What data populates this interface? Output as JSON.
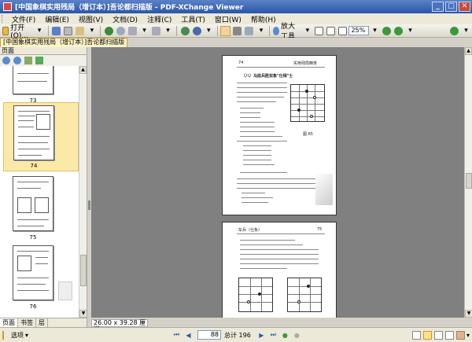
{
  "window": {
    "title": "[中国象棋实用残局（增订本）]吾论都扫描版 - PDF-XChange Viewer",
    "minimize": "_",
    "maximize": "□",
    "close": "✕"
  },
  "menu": {
    "items": [
      {
        "label": "文件(F)"
      },
      {
        "label": "编辑(E)"
      },
      {
        "label": "视图(V)"
      },
      {
        "label": "文档(D)"
      },
      {
        "label": "注释(C)"
      },
      {
        "label": "工具(T)"
      },
      {
        "label": "窗口(W)"
      },
      {
        "label": "帮助(H)"
      }
    ]
  },
  "toolbar": {
    "open_label": "打开(O)...",
    "zoom_in_label": "放大工具",
    "zoom_value": "25%"
  },
  "doc_tab": {
    "label": "[中国象棋实用残局（增订本）]吾论都扫描版"
  },
  "panel": {
    "title": "页面",
    "thumbnails": [
      {
        "label": "73"
      },
      {
        "label": "74"
      },
      {
        "label": "75"
      },
      {
        "label": "76"
      }
    ],
    "tabs": [
      {
        "label": "页面"
      },
      {
        "label": "书签"
      },
      {
        "label": "层"
      }
    ]
  },
  "page_top": {
    "page_number": "74",
    "header": "实用残局精萃",
    "heading": "（八）马底兵胜双象\"仕相\"士",
    "diagram_label": "图 65"
  },
  "page_bottom": {
    "header_left": "车兵（仕象）",
    "page_number": "75"
  },
  "status": {
    "options_label": "选项",
    "dimensions": "26.00 x 39.28 厘米",
    "current_page": "88",
    "total_pages": "总计 196"
  },
  "colors": {
    "titlebar": "#2a56a8",
    "thumb_selected": "#fbe9a8",
    "doc_bg": "#808080"
  }
}
